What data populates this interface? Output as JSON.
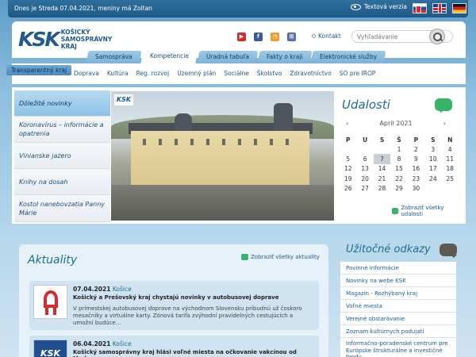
{
  "topbar": {
    "date_text": "Dnes je Streda 07.04.2021, meniny má Zoltan",
    "text_version": "Textová verzia"
  },
  "header": {
    "logo_mark": "KSK",
    "logo_lines": [
      "KOŠICKÝ",
      "SAMOSPRÁVNY",
      "KRAJ"
    ],
    "contact": "Kontakt",
    "search_placeholder": "Vyhľadávanie"
  },
  "tabs": [
    {
      "label": "Samospráva"
    },
    {
      "label": "Kompetencie",
      "active": true
    },
    {
      "label": "Úradná tabuľa"
    },
    {
      "label": "Fakty o kraji"
    },
    {
      "label": "Elektronické služby"
    }
  ],
  "subnav": {
    "current": "Transparentný kraj",
    "items": [
      "Doprava",
      "Kultúra",
      "Reg. rozvoj",
      "Územný plán",
      "Sociálne",
      "Školstvo",
      "Zdravotníctvo",
      "SO pre IROP"
    ]
  },
  "leftnav": [
    {
      "label": "Dôležité novinky",
      "active": true
    },
    {
      "label": "Koronavírus – informácie a opatrenia"
    },
    {
      "label": "Vinianske jazero"
    },
    {
      "label": "Knihy na dosah"
    },
    {
      "label": "Kostol nanebovzatia Panny Márie"
    }
  ],
  "photo": {
    "badge": "KSK"
  },
  "events": {
    "title": "Udalosti",
    "month": "April 2021",
    "prev": "‹",
    "next": "›",
    "weekdays": [
      "P",
      "U",
      "S",
      "Š",
      "P",
      "S",
      "N"
    ],
    "weeks": [
      [
        "",
        "",
        "",
        "1",
        "2",
        "3",
        "4"
      ],
      [
        "5",
        "6",
        "7",
        "8",
        "9",
        "10",
        "11"
      ],
      [
        "12",
        "13",
        "14",
        "15",
        "16",
        "17",
        "18"
      ],
      [
        "19",
        "20",
        "21",
        "22",
        "23",
        "24",
        "25"
      ],
      [
        "26",
        "27",
        "28",
        "29",
        "30",
        "",
        ""
      ]
    ],
    "today": "7",
    "all_link": "Zobraziť všetky udalosti"
  },
  "news": {
    "title": "Aktuality",
    "all_link": "Zobraziť všetky aktuality",
    "items": [
      {
        "date": "07.04.2021",
        "city": "Košice",
        "headline": "Košický a Prešovský kraj chystajú novinky v autobusovej doprave",
        "body": "V prímestskej autobusovej doprave na východnom Slovensku pribudnú už čoskoro mesačníky a virtuálne karty. Zónová tarifa zvýhodní pravidelných cestujúcich a umožní budúce..."
      },
      {
        "date": "06.04.2021",
        "city": "Košice",
        "headline": "Košický samosprávny kraj hlási voľné miesta na očkovanie vakcínou od Moderny",
        "body": "",
        "thumb": "KSK"
      }
    ]
  },
  "links": {
    "title": "Užitočné odkazy",
    "items": [
      "Povinné informácie",
      "Novinky na webe KSK",
      "Magazín - Rozhýbaný kraj",
      "Voľné miesta",
      "Verejné obstarávanie",
      "Zoznam kultúrnych podujatí",
      "Informačno-poradenské centrum pre Európske štrukturálne a investičné fondy"
    ]
  },
  "colors": {
    "brand": "#1f5b8e",
    "accent_green": "#3ab36a"
  }
}
